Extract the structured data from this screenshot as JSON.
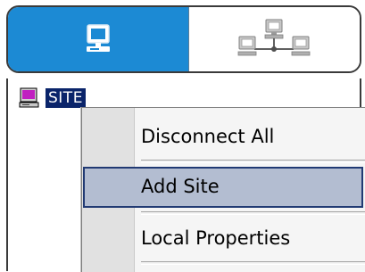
{
  "tabs": [
    {
      "name": "local",
      "icon": "computer-icon",
      "active": true
    },
    {
      "name": "network",
      "icon": "network-icon",
      "active": false
    }
  ],
  "tree": {
    "nodes": [
      {
        "label": "SITE",
        "icon": "computer-icon",
        "selected": true
      }
    ]
  },
  "context_menu": {
    "items": [
      {
        "label": "Disconnect All",
        "highlighted": false
      },
      {
        "label": "Add Site",
        "highlighted": true
      },
      {
        "label": "Local Properties",
        "highlighted": false
      }
    ]
  },
  "colors": {
    "active_tab": "#1c8ad4",
    "selection": "#0a246a",
    "menu_highlight": "#b3bdd1",
    "menu_highlight_border": "#213a73"
  }
}
